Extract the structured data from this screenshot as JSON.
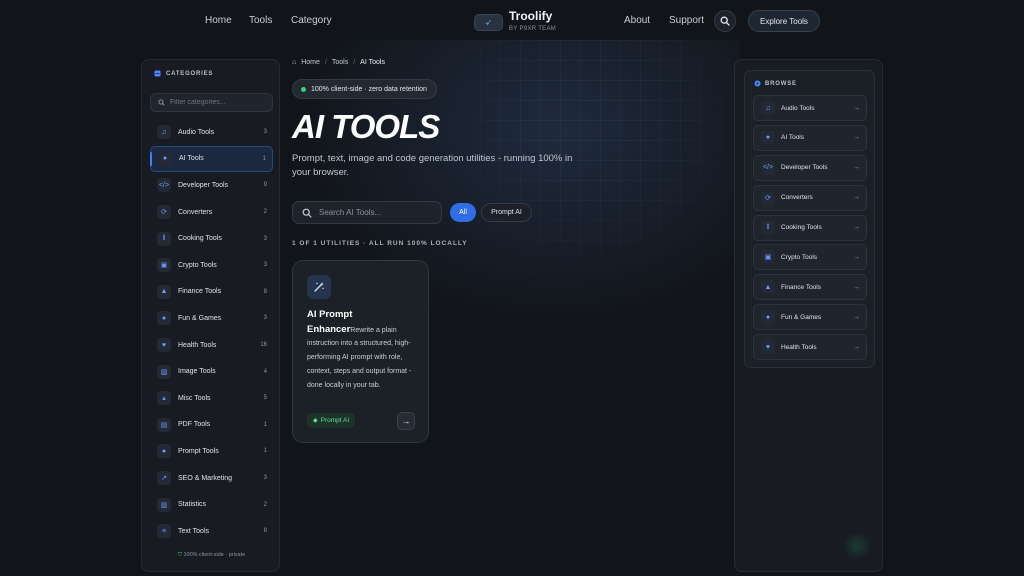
{
  "nav": {
    "links": [
      "Home",
      "Tools",
      "Category",
      "About",
      "Support"
    ],
    "brand_name": "Troolify",
    "brand_sub": "BY P9XR TEAM",
    "explore_label": "Explore Tools",
    "search_icon": "search-icon"
  },
  "sidebar": {
    "heading": "CATEGORIES",
    "filter_placeholder": "Filter categories...",
    "items": [
      {
        "label": "Audio Tools",
        "count": "3",
        "icon": "♫"
      },
      {
        "label": "AI Tools",
        "count": "1",
        "icon": "●",
        "active": true
      },
      {
        "label": "Developer Tools",
        "count": "9",
        "icon": "</>"
      },
      {
        "label": "Converters",
        "count": "2",
        "icon": "⟳"
      },
      {
        "label": "Cooking Tools",
        "count": "3",
        "icon": "ǁ"
      },
      {
        "label": "Crypto Tools",
        "count": "3",
        "icon": "▣"
      },
      {
        "label": "Finance Tools",
        "count": "8",
        "icon": "▲"
      },
      {
        "label": "Fun & Games",
        "count": "3",
        "icon": "●"
      },
      {
        "label": "Health Tools",
        "count": "16",
        "icon": "♥"
      },
      {
        "label": "Image Tools",
        "count": "4",
        "icon": "▧"
      },
      {
        "label": "Misc Tools",
        "count": "5",
        "icon": "▴"
      },
      {
        "label": "PDF Tools",
        "count": "1",
        "icon": "▤"
      },
      {
        "label": "Prompt Tools",
        "count": "1",
        "icon": "●"
      },
      {
        "label": "SEO & Marketing",
        "count": "3",
        "icon": "↗"
      },
      {
        "label": "Statistics",
        "count": "2",
        "icon": "▥"
      },
      {
        "label": "Text Tools",
        "count": "8",
        "icon": "≡"
      }
    ],
    "footer": "100% client-side · private"
  },
  "main": {
    "breadcrumb": [
      "Home",
      "Tools",
      "AI Tools"
    ],
    "retention_pill": "100% client-side · zero data retention",
    "title": "AI TOOLS",
    "subtitle": "Prompt, text, image and code generation utilities - running 100% in your browser.",
    "search_placeholder": "Search AI Tools...",
    "chips": [
      "All",
      "Prompt AI"
    ],
    "results_text": "1 OF 1 UTILITIES · ALL RUN 100% LOCALLY",
    "card": {
      "title": "AI Prompt Enhancer",
      "description": "Rewrite a plain instruction into a structured, high-performing AI prompt with role, context, steps and output format - done locally in your tab.",
      "tag": "Prompt AI",
      "icon": "magic-wand-icon"
    }
  },
  "browse": {
    "heading": "BROWSE",
    "items": [
      {
        "label": "Audio Tools",
        "icon": "♫"
      },
      {
        "label": "AI Tools",
        "icon": "●"
      },
      {
        "label": "Developer Tools",
        "icon": "</>"
      },
      {
        "label": "Converters",
        "icon": "⟳"
      },
      {
        "label": "Cooking Tools",
        "icon": "ǁ"
      },
      {
        "label": "Crypto Tools",
        "icon": "▣"
      },
      {
        "label": "Finance Tools",
        "icon": "▲"
      },
      {
        "label": "Fun & Games",
        "icon": "●"
      },
      {
        "label": "Health Tools",
        "icon": "♥"
      }
    ]
  },
  "colors": {
    "accent": "#2f6ee6",
    "success": "#35d07f",
    "background": "#111418"
  }
}
